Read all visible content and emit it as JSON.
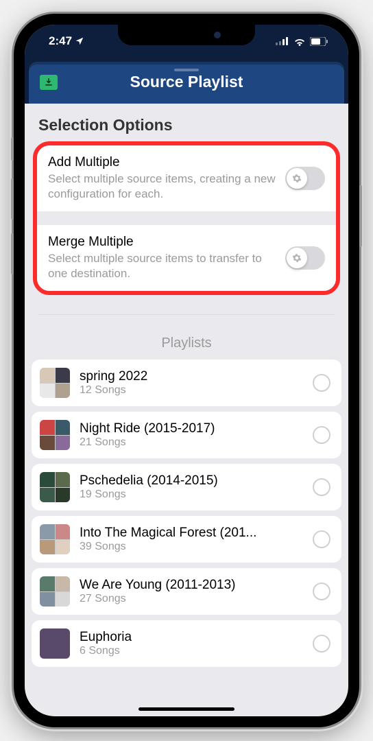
{
  "status": {
    "time": "2:47",
    "location_arrow": "➤"
  },
  "header": {
    "title": "Source Playlist"
  },
  "section_title": "Selection Options",
  "options": [
    {
      "title": "Add Multiple",
      "desc": "Select multiple source items, creating a new configuration for each."
    },
    {
      "title": "Merge Multiple",
      "desc": "Select multiple source items to transfer to one destination."
    }
  ],
  "playlists_label": "Playlists",
  "playlists": [
    {
      "name": "spring 2022",
      "count": "12 Songs",
      "art": [
        "#d8c8b8",
        "#3a3a4a",
        "#e8e8e8",
        "#b0a090"
      ]
    },
    {
      "name": "Night Ride (2015-2017)",
      "count": "21 Songs",
      "art": [
        "#c44",
        "#3a5a6a",
        "#6a4a3a",
        "#8a6a9a"
      ]
    },
    {
      "name": "Pschedelia (2014-2015)",
      "count": "19 Songs",
      "art": [
        "#2a4a3a",
        "#5a6a4a",
        "#3a5a4a",
        "#2a3a2a"
      ]
    },
    {
      "name": "Into The Magical Forest (201...",
      "count": "39 Songs",
      "art": [
        "#8a9aa8",
        "#c88",
        "#b89a7a",
        "#e0d0c0"
      ]
    },
    {
      "name": "We Are Young (2011-2013)",
      "count": "27 Songs",
      "art": [
        "#5a7a6a",
        "#c8b8a8",
        "#8090a0",
        "#d8d8d8"
      ]
    },
    {
      "name": "Euphoria",
      "count": "6 Songs",
      "art_single": "#5a4a6a"
    }
  ]
}
